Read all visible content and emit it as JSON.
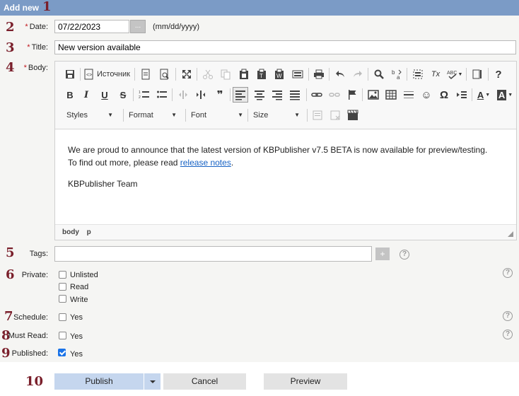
{
  "header": {
    "title": "Add new",
    "marker": "1"
  },
  "markers": {
    "date": "2",
    "title": "3",
    "body": "4",
    "tags": "5",
    "private": "6",
    "schedule": "7",
    "must_read": "8",
    "published": "9",
    "buttons": "10"
  },
  "required_mark": "*",
  "date": {
    "label": "Date:",
    "value": "07/22/2023",
    "picker_label": "...",
    "format_hint": "(mm/dd/yyyy)"
  },
  "title_field": {
    "label": "Title:",
    "value": "New version available"
  },
  "body": {
    "label": "Body:",
    "toolbar": {
      "source_label": "Источник",
      "combos": {
        "styles": "Styles",
        "format": "Format",
        "font": "Font",
        "size": "Size"
      },
      "glyphs": {
        "italic": "I",
        "quote": "❞",
        "omega": "Ω",
        "help": "?",
        "bold": "B",
        "underline": "U",
        "strike": "S",
        "smiley": "☺",
        "text_color": "A",
        "bg_color": "A",
        "clear_format": "Tx"
      }
    },
    "content": {
      "line1": "We are proud to announce that the latest version of KBPublisher v7.5 BETA is now available for preview/testing.",
      "line2_prefix": "To find out more, please read ",
      "link": "release notes",
      "line2_suffix": ".",
      "signature": "KBPublisher Team"
    },
    "statusbar": [
      "body",
      "p"
    ]
  },
  "tags": {
    "label": "Tags:",
    "value": "",
    "add_label": "+"
  },
  "private": {
    "label": "Private:",
    "options": [
      "Unlisted",
      "Read",
      "Write"
    ]
  },
  "schedule": {
    "label": "Schedule:",
    "option": "Yes",
    "checked": false
  },
  "must_read": {
    "label": "Must Read:",
    "option": "Yes",
    "checked": false
  },
  "published": {
    "label": "Published:",
    "option": "Yes",
    "checked": true
  },
  "help_glyph": "?",
  "buttons": {
    "publish": "Publish",
    "cancel": "Cancel",
    "preview": "Preview"
  },
  "colors": {
    "header_bg": "#7b9bc6",
    "marker": "#7a1f2b",
    "primary_button": "#c5d6ee",
    "link": "#1762c4",
    "checkbox_on": "#1a73e8"
  }
}
